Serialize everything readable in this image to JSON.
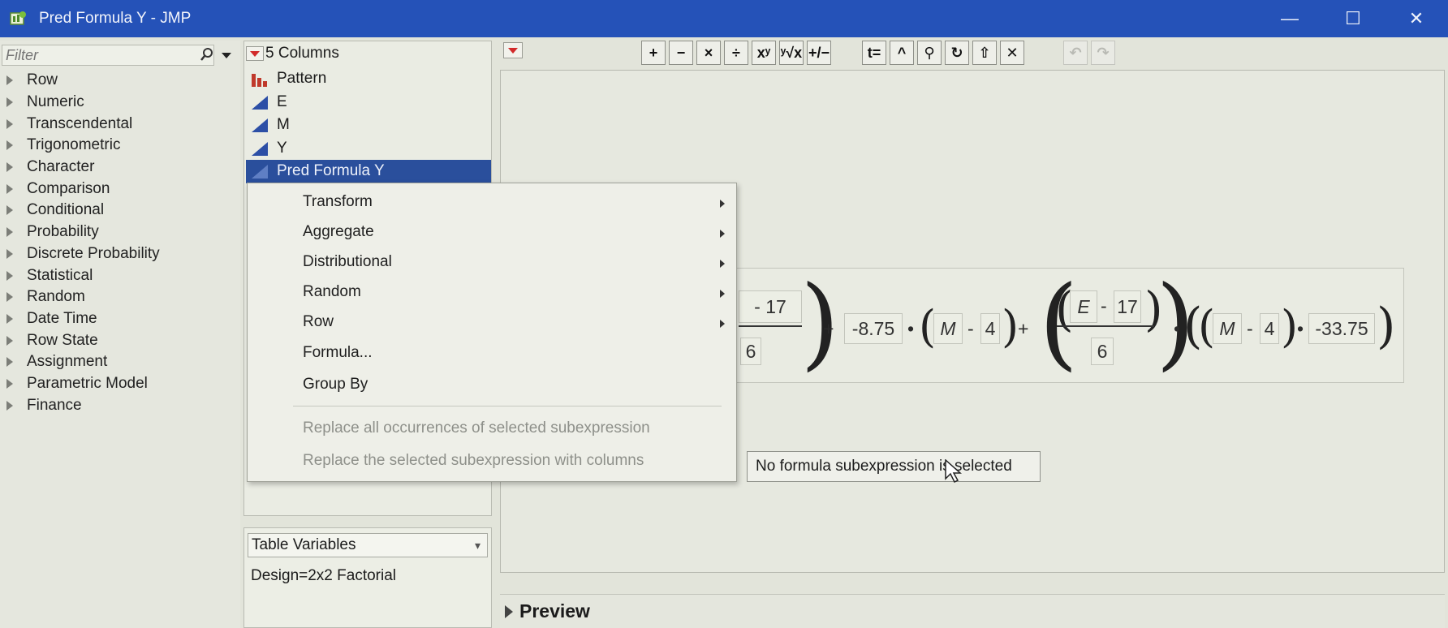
{
  "window": {
    "title": "Pred Formula Y - JMP",
    "controls": {
      "minimize": "—",
      "maximize": "☐",
      "close": "✕"
    }
  },
  "function_panel": {
    "filter_placeholder": "Filter",
    "categories": [
      "Row",
      "Numeric",
      "Transcendental",
      "Trigonometric",
      "Character",
      "Comparison",
      "Conditional",
      "Probability",
      "Discrete Probability",
      "Statistical",
      "Random",
      "Date Time",
      "Row State",
      "Assignment",
      "Parametric Model",
      "Finance"
    ]
  },
  "columns_panel": {
    "header": "5 Columns",
    "columns": [
      {
        "name": "Pattern",
        "icon": "nominal-bar-icon"
      },
      {
        "name": "E",
        "icon": "continuous-icon"
      },
      {
        "name": "M",
        "icon": "continuous-icon"
      },
      {
        "name": "Y",
        "icon": "continuous-icon"
      },
      {
        "name": "Pred Formula Y",
        "icon": "continuous-icon",
        "selected": true
      }
    ]
  },
  "table_variables": {
    "select_label": "Table Variables",
    "value": "Design=2x2 Factorial"
  },
  "context_menu": {
    "items": [
      {
        "label": "Transform",
        "submenu": true
      },
      {
        "label": "Aggregate",
        "submenu": true
      },
      {
        "label": "Distributional",
        "submenu": true
      },
      {
        "label": "Random",
        "submenu": true
      },
      {
        "label": "Row",
        "submenu": true
      },
      {
        "label": "Formula...",
        "submenu": false
      },
      {
        "label": "Group By",
        "submenu": false
      }
    ],
    "disabled_items": [
      "Replace all occurrences of selected subexpression",
      "Replace the selected subexpression with columns"
    ]
  },
  "toolbar": {
    "buttons": [
      "+",
      "−",
      "×",
      "÷",
      "xʸ",
      "ʸ√x",
      "+/−",
      "t=",
      "^",
      "⚲",
      "↻",
      "⇧",
      "✕",
      "↶",
      "↷"
    ]
  },
  "formula": {
    "part1_num": "- 17",
    "part1_den": "6",
    "plus1": "+",
    "coef1": "-8.75",
    "dot1": "•",
    "m_var": "M",
    "minus": "-",
    "four": "4",
    "plus2": "+",
    "e_var": "E",
    "seventeen": "17",
    "six": "6",
    "dot2": "•",
    "dot3": "•",
    "coef2": "-33.75"
  },
  "status": {
    "message": "No formula subexpression is selected"
  },
  "preview": {
    "label": "Preview"
  }
}
